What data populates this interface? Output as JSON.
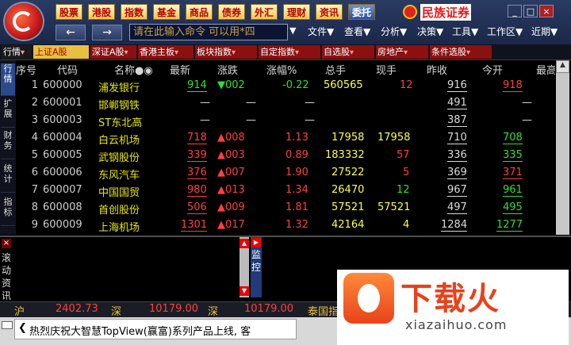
{
  "toolbar": {
    "market_buttons": [
      {
        "label": "股票"
      },
      {
        "label": "港股"
      },
      {
        "label": "指数"
      },
      {
        "label": "基金"
      },
      {
        "label": "商品"
      },
      {
        "label": "债券"
      },
      {
        "label": "外汇"
      },
      {
        "label": "理财"
      },
      {
        "label": "资讯"
      },
      {
        "label": "委托"
      }
    ],
    "brand": "民族证券",
    "command_placeholder": "请在此输入命令    可以用*四",
    "menus": [
      "文件▼",
      "查看▼",
      "分析▼",
      "决策▼",
      "工具▼",
      "工作区▼",
      "近期▼"
    ],
    "window_controls": [
      "_",
      "□",
      "×"
    ]
  },
  "tabs": [
    {
      "label": "行情"
    },
    {
      "label": "上证A股"
    },
    {
      "label": "深证A股"
    },
    {
      "label": "香港主板"
    },
    {
      "label": "板块指数"
    },
    {
      "label": "自定指数"
    },
    {
      "label": "自选股"
    },
    {
      "label": "房地产"
    },
    {
      "label": "条件选股"
    }
  ],
  "side_tabs": [
    "行情",
    "扩展",
    "财务",
    "统计",
    "指标"
  ],
  "table": {
    "headers": [
      "序号",
      "代码",
      "名称●◉",
      "最新",
      "涨跌",
      "涨幅%",
      "总手",
      "现手",
      "昨收",
      "今开",
      "最高"
    ],
    "rows": [
      {
        "idx": "1",
        "code": "600000",
        "name": "浦发银行",
        "last": "914",
        "chg": "▼002",
        "pct": "-0.22",
        "vol": "560565",
        "cur": "12",
        "prev": "916",
        "open": "918"
      },
      {
        "idx": "2",
        "code": "600001",
        "name": "邯郸钢铁",
        "last": "—",
        "chg": "—",
        "pct": "—",
        "vol": "",
        "cur": "",
        "prev": "491",
        "open": "—"
      },
      {
        "idx": "3",
        "code": "600003",
        "name": "ST东北高",
        "last": "—",
        "chg": "—",
        "pct": "—",
        "vol": "",
        "cur": "",
        "prev": "387",
        "open": "—"
      },
      {
        "idx": "4",
        "code": "600004",
        "name": "白云机场",
        "last": "718",
        "chg": "▲008",
        "pct": "1.13",
        "vol": "17958",
        "cur": "17958",
        "prev": "710",
        "open": "708"
      },
      {
        "idx": "5",
        "code": "600005",
        "name": "武钢股份",
        "last": "339",
        "chg": "▲003",
        "pct": "0.89",
        "vol": "183332",
        "cur": "57",
        "prev": "336",
        "open": "335"
      },
      {
        "idx": "6",
        "code": "600006",
        "name": "东风汽车",
        "last": "376",
        "chg": "▲007",
        "pct": "1.90",
        "vol": "27522",
        "cur": "5",
        "prev": "369",
        "open": "371"
      },
      {
        "idx": "7",
        "code": "600007",
        "name": "中国国贸",
        "last": "980",
        "chg": "▲013",
        "pct": "1.34",
        "vol": "26470",
        "cur": "12",
        "prev": "967",
        "open": "961"
      },
      {
        "idx": "8",
        "code": "600008",
        "name": "首创股份",
        "last": "506",
        "chg": "▲009",
        "pct": "1.81",
        "vol": "57521",
        "cur": "57521",
        "prev": "497",
        "open": "495"
      },
      {
        "idx": "9",
        "code": "600009",
        "name": "上海机场",
        "last": "1301",
        "chg": "▲017",
        "pct": "1.32",
        "vol": "42164",
        "cur": "4",
        "prev": "1284",
        "open": "1277"
      }
    ]
  },
  "lower": {
    "scroll_label": "滚动资讯",
    "monitor_label": "监控"
  },
  "ticker": [
    {
      "name": "沪",
      "value": "2402.73"
    },
    {
      "name": "深",
      "value": "10179.00"
    },
    {
      "name": "深",
      "value": "10179.00"
    },
    {
      "name": "泰国指"
    }
  ],
  "news": {
    "text": "热烈庆祝大智慧TopView(赢富)系列产品上线, 客"
  },
  "watermark": {
    "title": "下载火",
    "url": "xiazaihuo.com"
  }
}
